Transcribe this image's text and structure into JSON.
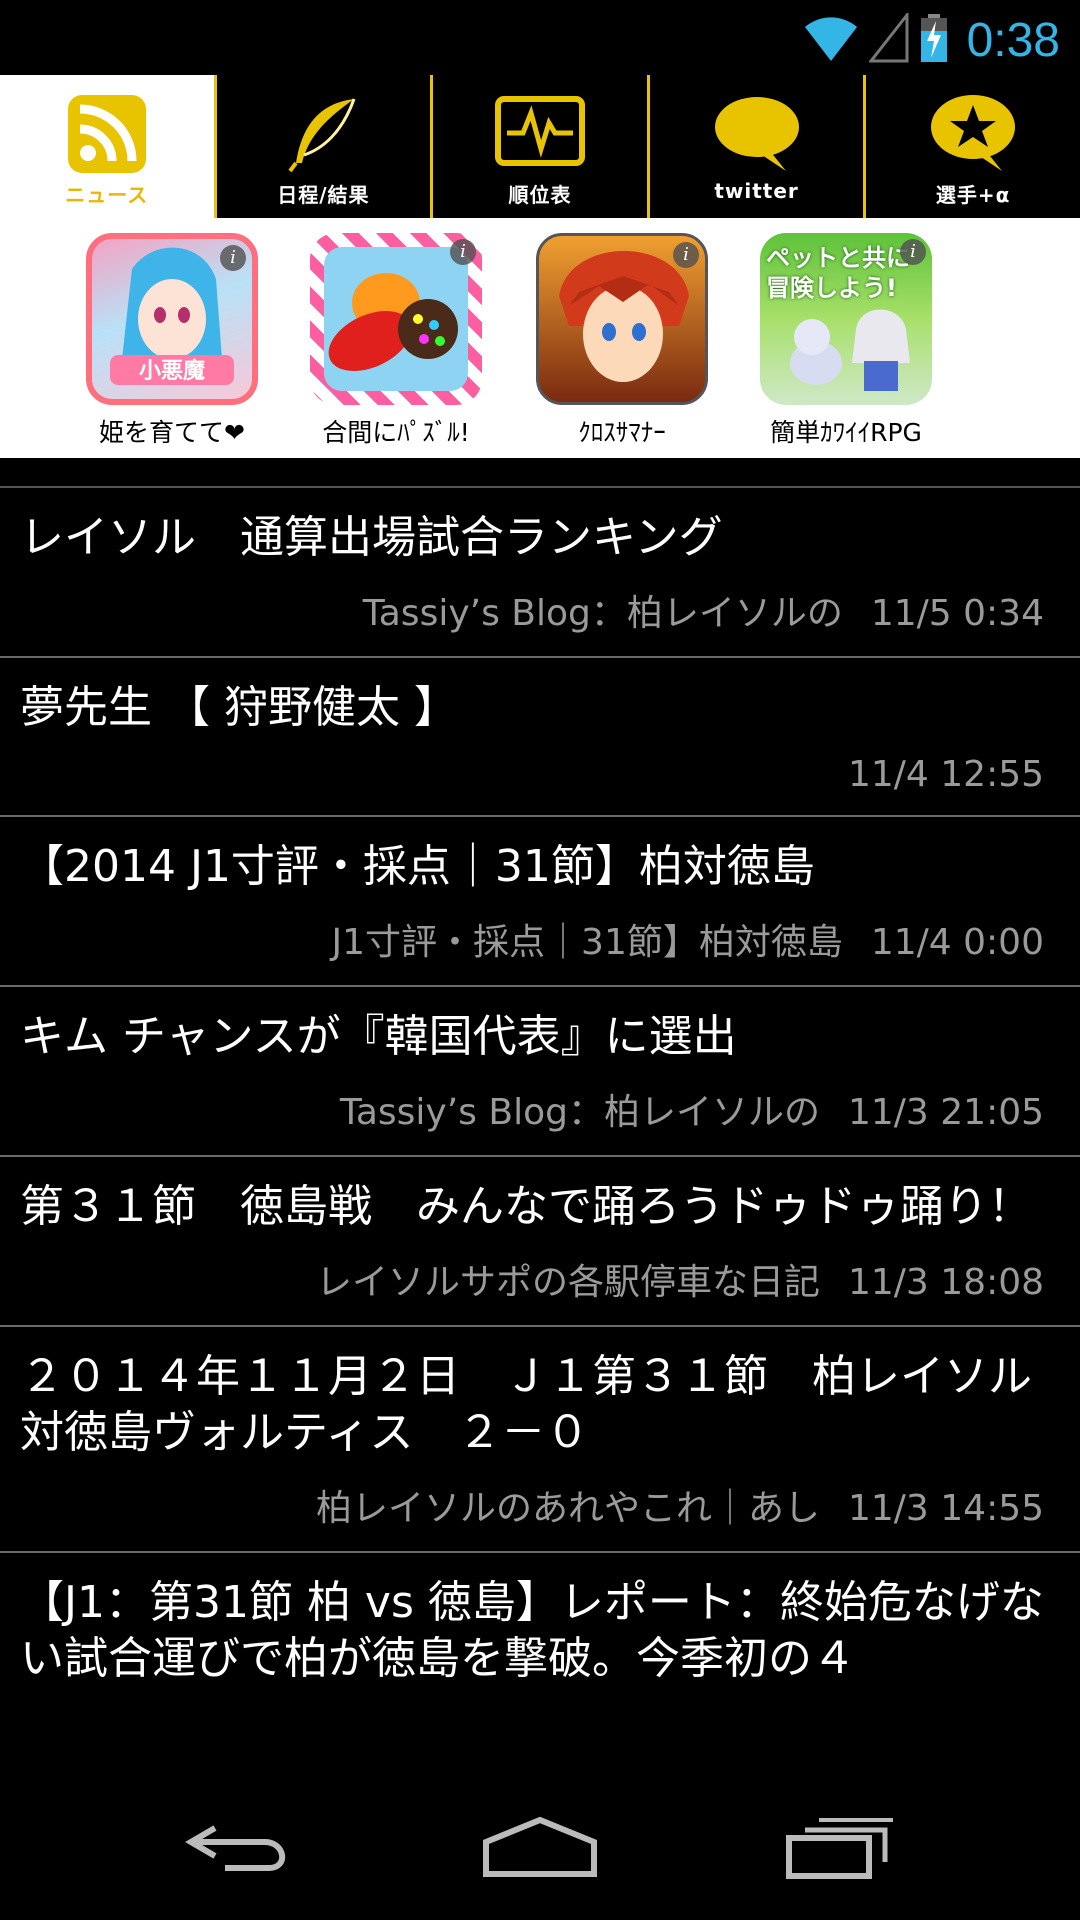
{
  "status_bar": {
    "time": "0:38",
    "icons": [
      "wifi-icon",
      "cell-signal-icon",
      "battery-charging-icon"
    ]
  },
  "tabs": [
    {
      "label": "ニュース",
      "icon": "rss-icon",
      "active": true
    },
    {
      "label": "日程/結果",
      "icon": "feather-icon",
      "active": false
    },
    {
      "label": "順位表",
      "icon": "chart-monitor-icon",
      "active": false
    },
    {
      "label": "twitter",
      "icon": "speech-bubble-icon",
      "active": false
    },
    {
      "label": "選手+α",
      "icon": "star-bubble-icon",
      "active": false
    }
  ],
  "ads": [
    {
      "label": "姫を育てて❤",
      "badge": "小悪魔"
    },
    {
      "label": "合間にﾊﾟｽﾞﾙ!"
    },
    {
      "label": "ｸﾛｽｻﾏﾅｰ"
    },
    {
      "label": "簡単ｶﾜｲｲRPG",
      "badge": "ペットと共に冒険しよう!"
    }
  ],
  "news": [
    {
      "title": "レイソル　通算出場試合ランキング",
      "source": "Tassiy’s Blog：柏レイソルの",
      "date": "11/5 0:34"
    },
    {
      "title": "夢先生 【 狩野健太 】",
      "source": "",
      "date": "11/4 12:55"
    },
    {
      "title": "【2014 J1寸評・採点｜31節】柏対徳島",
      "source": "J1寸評・採点｜31節】柏対徳島",
      "date": "11/4 0:00"
    },
    {
      "title": "キム チャンスが『韓国代表』に選出",
      "source": "Tassiy’s Blog：柏レイソルの",
      "date": "11/3 21:05"
    },
    {
      "title": "第３１節　徳島戦　みんなで踊ろうドゥドゥ踊り！",
      "source": "レイソルサポの各駅停車な日記",
      "date": "11/3 18:08"
    },
    {
      "title": "２０１４年１１月２日　Ｊ１第３１節　柏レイソル対徳島ヴォルティス　２－０",
      "source": "柏レイソルのあれやこれ｜あし",
      "date": "11/3 14:55"
    },
    {
      "title": "【J1：第31節 柏 vs 徳島】レポート：終始危なげない試合運びで柏が徳島を撃破。今季初の４",
      "source": "",
      "date": ""
    }
  ],
  "nav": [
    "back-icon",
    "home-icon",
    "recent-apps-icon"
  ]
}
